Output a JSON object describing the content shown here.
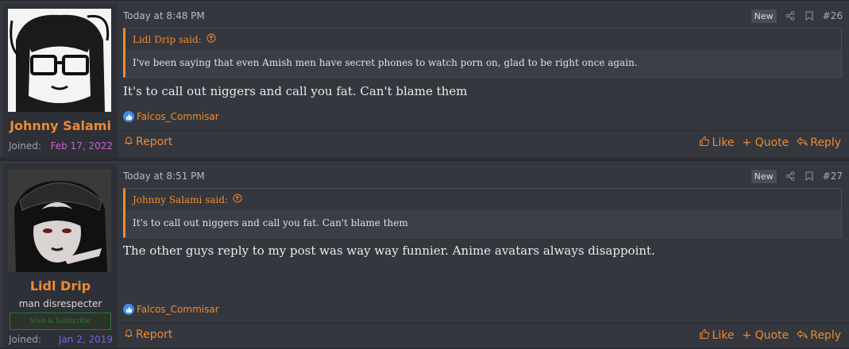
{
  "colors": {
    "accent": "#ee8a33",
    "background": "#34373e",
    "user_panel": "#2d3036"
  },
  "posts": [
    {
      "timestamp": "Today at 8:48 PM",
      "new_badge": "New",
      "number": "#26",
      "user": {
        "name": "Johnny Salami",
        "joined_label": "Joined:",
        "joined_date": "Feb 17, 2022",
        "date_color": "#d05fd0"
      },
      "quote": {
        "author": "Lidl Drip said:",
        "text": "I've been saying that even Amish men have secret phones to watch porn on, glad to be right once again."
      },
      "message": "It's to call out niggers and call you fat. Can't blame them",
      "reaction_user": "Falcos_Commisar",
      "footer": {
        "report": "Report",
        "like": "Like",
        "quote": "+ Quote",
        "reply": "Reply"
      }
    },
    {
      "timestamp": "Today at 8:51 PM",
      "new_badge": "New",
      "number": "#27",
      "user": {
        "name": "Lidl Drip",
        "title": "man disrespecter",
        "banner": "Visit & Subscribe",
        "joined_label": "Joined:",
        "joined_date": "Jan 2, 2019",
        "date_color": "#7b63e0"
      },
      "quote": {
        "author": "Johnny Salami said:",
        "text": "It's to call out niggers and call you fat. Can't blame them"
      },
      "message": "The other guys reply to my post was way way funnier. Anime avatars always disappoint.",
      "reaction_user": "Falcos_Commisar",
      "footer": {
        "report": "Report",
        "like": "Like",
        "quote": "+ Quote",
        "reply": "Reply"
      }
    }
  ]
}
